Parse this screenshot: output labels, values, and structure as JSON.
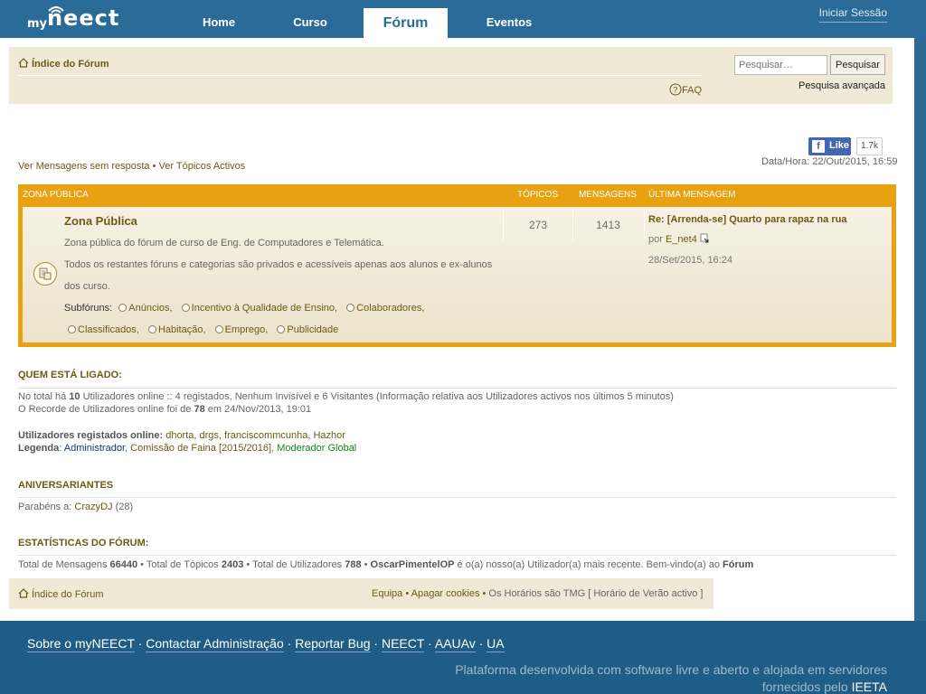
{
  "brand": {
    "my": "my",
    "name": "neect"
  },
  "nav": {
    "tabs": [
      {
        "label": "Home"
      },
      {
        "label": "Curso"
      },
      {
        "label": "Fórum"
      },
      {
        "label": "Eventos"
      }
    ],
    "login": "Iniciar Sessão"
  },
  "header": {
    "breadcrumb": "Índice do Fórum",
    "faq": "FAQ",
    "search": {
      "placeholder": "Pesquisar…",
      "button": "Pesquisar",
      "advanced": "Pesquisa avançada"
    }
  },
  "social": {
    "like": "Like",
    "count": "1.7k"
  },
  "quicklinks": {
    "unanswered": "Ver Mensagens sem resposta",
    "sep": "•",
    "active": "Ver Tópicos Activos"
  },
  "datetime": "Data/Hora: 22/Out/2015, 16:59",
  "forum_table": {
    "headers": {
      "zone": "ZONA PÚBLICA",
      "topics": "TÓPICOS",
      "posts": "MENSAGENS",
      "last": "ÚLTIMA MENSAGEM"
    },
    "row": {
      "title": "Zona Pública",
      "desc1": "Zona pública do fórum de curso de Eng. de Computadores e Telemática.",
      "desc2": "Todos os restantes fóruns e categorias são privados e acessíveis apenas aos alunos e ex-alunos",
      "desc3": "dos curso.",
      "subforums_label": "Subfóruns:",
      "subforums": [
        "Anúncios",
        "Incentivo à Qualidade de Ensino",
        "Colaboradores",
        "Classificados",
        "Habitação",
        "Emprego",
        "Publicidade"
      ],
      "topics": "273",
      "posts": "1413",
      "last_post": {
        "title": "Re: [Arrenda-se] Quarto para rapaz na rua",
        "by_label": "por",
        "by": "E_net4",
        "date": "28/Set/2015, 16:24"
      }
    }
  },
  "online": {
    "title": "QUEM ESTÁ LIGADO:",
    "line1_pre": "No total há",
    "line1_count": "10",
    "line1_post": "Utilizadores online :: 4 registados, Nenhum Invisível e 6 Visitantes (Informação relativa aos Utilizadores activos nos últimos 5 minutos)",
    "line2_pre": "O Recorde de Utilizadores online foi de",
    "line2_count": "78",
    "line2_post": "em 24/Nov/2013, 19:01",
    "registered_label": "Utilizadores registados online:",
    "registered": "dhorta, drgs, franciscommcunha, Hazhor",
    "legend_label": "Legenda",
    "legend_admin": "Administrador",
    "legend_faina": "Comissão de Faina [2015/2016]",
    "legend_mod": "Moderador Global"
  },
  "birthdays": {
    "title": "ANIVERSARIANTES",
    "label": "Parabéns a:",
    "user": "CrazyDJ",
    "age": "(28)"
  },
  "stats": {
    "title": "ESTATÍSTICAS DO FÓRUM:",
    "posts_label": "Total de Mensagens",
    "posts": "66440",
    "topics_label": "Total de Tópicos",
    "topics": "2403",
    "users_label": "Total de Utilizadores",
    "users": "788",
    "newest": "OscarPimentelOP",
    "newest_post": "é o(a) nosso(a) Utilizador(a) mais recente. Bem-vindo(a) ao",
    "forum": "Fórum"
  },
  "footer_box": {
    "breadcrumb": "Índice do Fórum",
    "team": "Equipa",
    "delete_cookies": "Apagar cookies",
    "timezone": "Os Horários são TMG [ Horário de Verão activo ]"
  },
  "site_footer": {
    "links": [
      "Sobre o myNEECT",
      "Contactar Administração",
      "Reportar Bug",
      "NEECT",
      "AAUAv",
      "UA"
    ],
    "platform_line1": "Plataforma desenvolvida com software livre e aberto e alojada em servidores",
    "platform_line2": "fornecidos pelo",
    "ieeta": "IEETA"
  }
}
